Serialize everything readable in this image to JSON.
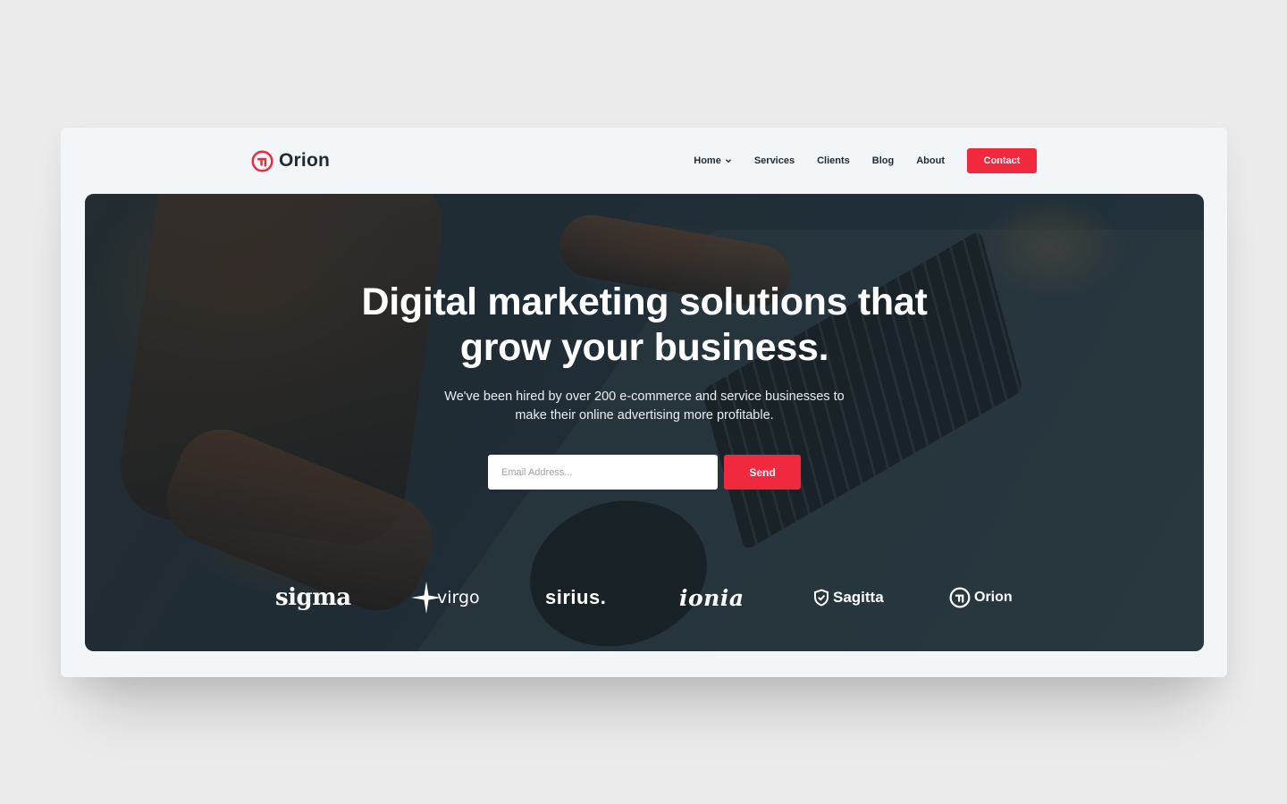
{
  "header": {
    "logo_text": "Orion",
    "nav": {
      "home": "Home",
      "services": "Services",
      "clients": "Clients",
      "blog": "Blog",
      "about": "About"
    },
    "contact_label": "Contact"
  },
  "hero": {
    "title_line1": "Digital marketing solutions that",
    "title_line2": "grow your business.",
    "subtitle_line1": "We've been hired by over 200 e-commerce and service businesses to",
    "subtitle_line2": "make their online advertising more profitable.",
    "email_placeholder": "Email Address...",
    "send_label": "Send"
  },
  "brands": [
    "sigma",
    "virgo",
    "sirius.",
    "ionia",
    "Sagitta",
    "Orion"
  ],
  "colors": {
    "accent": "#f0293e",
    "text_dark": "#1f2a33",
    "card_bg": "#f3f6f8",
    "page_bg": "#ebebeb"
  },
  "icons": {
    "logo": "orion-logo-icon",
    "nav_dropdown": "chevron-down-icon",
    "virgo": "star-icon",
    "sagitta": "shield-check-icon",
    "orion": "orion-logo-icon"
  }
}
